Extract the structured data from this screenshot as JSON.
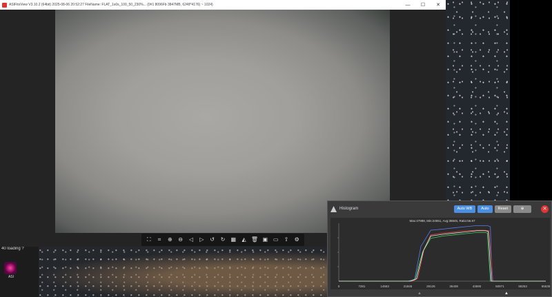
{
  "window": {
    "title": "ASIFitsView V3.10.2 (64bit) 2025-08-06 20:52:27 FileName: FLAT_1s0s_100_50_230%... (0#1 8096Fb 3847MB, 6248*4176) ~ 1024)",
    "minimize": "—",
    "maximize": "☐",
    "close": "✕"
  },
  "toolbar": {
    "items": [
      {
        "name": "fit-frame-icon",
        "glyph": "⛶"
      },
      {
        "name": "crop-icon",
        "glyph": "⌗"
      },
      {
        "name": "zoom-in-icon",
        "glyph": "⊕"
      },
      {
        "name": "zoom-out-icon",
        "glyph": "⊖"
      },
      {
        "name": "previous-icon",
        "glyph": "◁"
      },
      {
        "name": "next-icon",
        "glyph": "▷"
      },
      {
        "name": "rotate-left-icon",
        "glyph": "↺"
      },
      {
        "name": "rotate-right-icon",
        "glyph": "↻"
      },
      {
        "name": "debayer-icon",
        "glyph": "▦"
      },
      {
        "name": "histogram-icon",
        "glyph": "◭"
      },
      {
        "name": "delete-icon",
        "glyph": "🗑"
      },
      {
        "name": "save-icon",
        "glyph": "▣"
      },
      {
        "name": "image-icon",
        "glyph": "▭"
      },
      {
        "name": "export-icon",
        "glyph": "⇧"
      },
      {
        "name": "settings-icon",
        "glyph": "⚙"
      }
    ]
  },
  "desktop": {
    "top_label": "40 loading ?",
    "icon_label": "ASI"
  },
  "histogram": {
    "title": "Histogram",
    "buttons": {
      "auto_wb": "Auto WB",
      "auto": "Auto",
      "reset": "Reset",
      "zoom": "⊕"
    },
    "close": "✕",
    "stats": "Max:47988, Min:24551, Avg:38845, Ratio:56.67",
    "x_ticks": [
      "0",
      "7281",
      "14563",
      "21845",
      "29126",
      "36408",
      "43690",
      "50971",
      "58253",
      "65535"
    ],
    "colors": {
      "red": "#e04040",
      "green": "#3fd060",
      "blue": "#5a7cf0",
      "white": "#e8e8e8"
    },
    "chart_data": {
      "type": "line",
      "xlim": [
        0,
        65535
      ],
      "series": [
        {
          "name": "",
          "color": "#5a7cf0",
          "x": [
            0,
            21845,
            24000,
            26000,
            29126,
            33000,
            36408,
            40000,
            43690,
            47000,
            47988,
            48500,
            65535
          ],
          "y": [
            0,
            0,
            3,
            60,
            88,
            90,
            92,
            94,
            96,
            96,
            94,
            0,
            0
          ]
        },
        {
          "name": "",
          "color": "#e04040",
          "x": [
            0,
            23500,
            25000,
            27000,
            29126,
            33000,
            36408,
            40000,
            43690,
            46000,
            47500,
            48800,
            65535
          ],
          "y": [
            0,
            0,
            5,
            55,
            80,
            83,
            85,
            87,
            88,
            88,
            87,
            0,
            0
          ]
        },
        {
          "name": "",
          "color": "#3fd060",
          "x": [
            0,
            22500,
            24200,
            26500,
            29126,
            33000,
            36408,
            40000,
            43690,
            46500,
            47000,
            48000,
            65535
          ],
          "y": [
            0,
            0,
            4,
            50,
            74,
            78,
            80,
            82,
            84,
            84,
            83,
            0,
            0
          ]
        },
        {
          "name": "",
          "color": "#e8e8e8",
          "x": [
            0,
            22800,
            24600,
            26800,
            29126,
            33000,
            36408,
            40000,
            43690,
            46500,
            47300,
            48300,
            65535
          ],
          "y": [
            0,
            0,
            4,
            53,
            78,
            81,
            83,
            85,
            87,
            87,
            86,
            0,
            0
          ]
        }
      ],
      "markers": {
        "black_point": 0.39,
        "white_point": 0.81
      }
    }
  }
}
